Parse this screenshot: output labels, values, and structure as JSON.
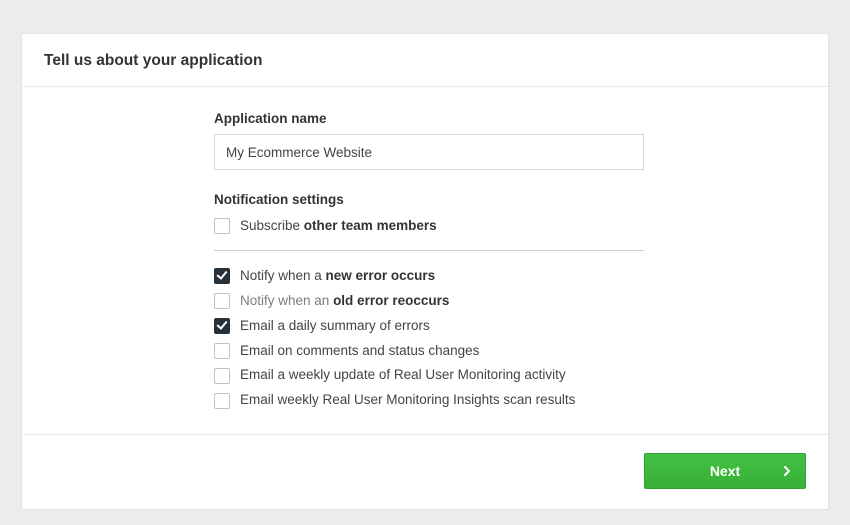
{
  "header": {
    "title": "Tell us about your application"
  },
  "app_name": {
    "label": "Application name",
    "value": "My Ecommerce Website"
  },
  "notifications": {
    "section_label": "Notification settings",
    "subscribe": {
      "checked": false,
      "pre": "Subscribe ",
      "bold": "other team members"
    },
    "items": [
      {
        "checked": true,
        "pre": "Notify when a ",
        "bold": "new error occurs",
        "post": ""
      },
      {
        "checked": false,
        "pre": "Notify when an ",
        "bold": "old error reoccurs",
        "post": "",
        "dim": true
      },
      {
        "checked": true,
        "pre": "Email a daily summary of errors",
        "bold": "",
        "post": ""
      },
      {
        "checked": false,
        "pre": "Email on comments and status changes",
        "bold": "",
        "post": ""
      },
      {
        "checked": false,
        "pre": "Email a weekly update of Real User Monitoring activity",
        "bold": "",
        "post": ""
      },
      {
        "checked": false,
        "pre": "Email weekly Real User Monitoring Insights scan results",
        "bold": "",
        "post": ""
      }
    ]
  },
  "footer": {
    "next_label": "Next"
  }
}
